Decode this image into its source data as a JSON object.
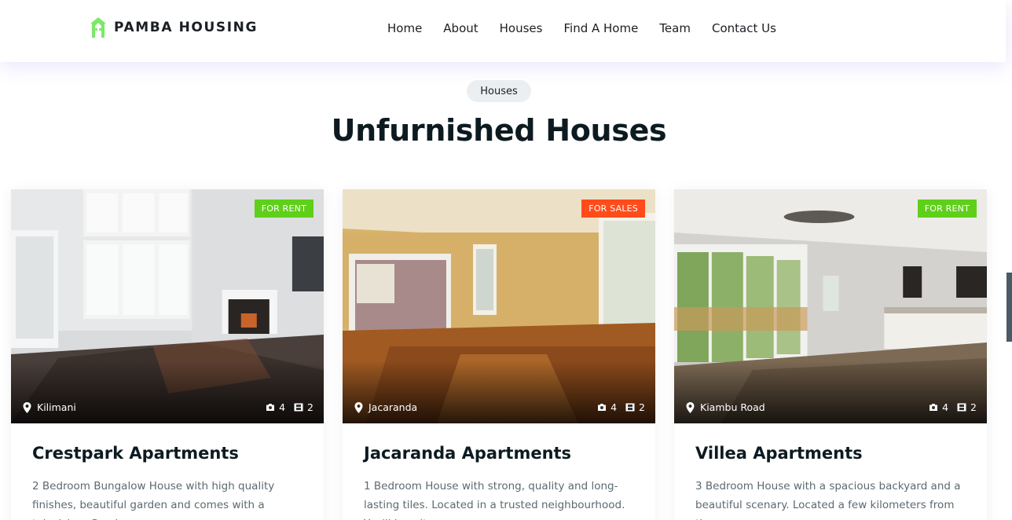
{
  "header": {
    "brand": "PAMBA HOUSING",
    "nav": [
      "Home",
      "About",
      "Houses",
      "Find A Home",
      "Team",
      "Contact Us"
    ]
  },
  "section": {
    "pill": "Houses",
    "title": "Unfurnished Houses"
  },
  "cards": [
    {
      "badge": "FOR RENT",
      "badge_color": "#5fd019",
      "location": "Kilimani",
      "photos": "4",
      "videos": "2",
      "title": "Crestpark Apartments",
      "desc": "2 Bedroom Bungalow House with high quality finishes, beautiful garden and comes with a television. Good"
    },
    {
      "badge": "FOR SALES",
      "badge_color": "#ff4c1a",
      "location": "Jacaranda",
      "photos": "4",
      "videos": "2",
      "title": "Jacaranda Apartments",
      "desc": "1 Bedroom House with strong, quality and long-lasting tiles. Located in a trusted neighbourhood. You'll love it"
    },
    {
      "badge": "FOR RENT",
      "badge_color": "#5fd019",
      "location": "Kiambu Road",
      "photos": "4",
      "videos": "2",
      "title": "Villea Apartments",
      "desc": "3 Bedroom House with a spacious backyard and a beautiful scenary. Located a few kilometers from the"
    }
  ],
  "icons": {
    "logo": "house-logo-icon",
    "location": "map-pin-icon",
    "photos": "camera-icon",
    "videos": "film-icon"
  },
  "colors": {
    "brand_green": "#7be86a",
    "rent_badge": "#5fd019",
    "sale_badge": "#ff4c1a"
  }
}
